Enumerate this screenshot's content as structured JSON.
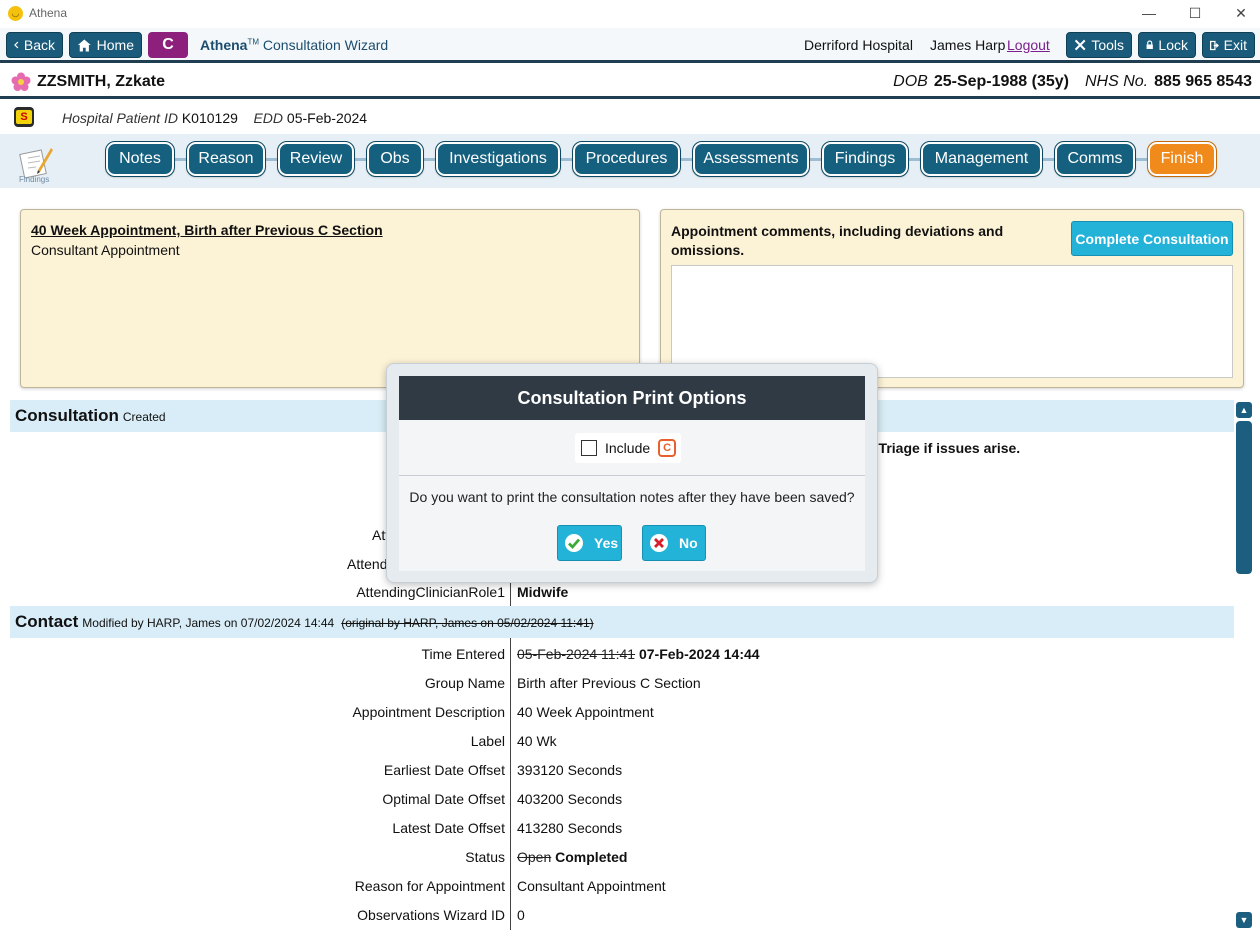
{
  "window": {
    "title": "Athena",
    "minimize": "—",
    "maximize": "☐",
    "close": "✕"
  },
  "topnav": {
    "back": "Back",
    "home": "Home",
    "c_badge": "C",
    "app_name": "Athena",
    "tm": "TM",
    "app_sub": "Consultation Wizard",
    "hospital": "Derriford Hospital",
    "user": "James Harp",
    "logout": "Logout",
    "tools": "Tools",
    "lock": "Lock",
    "exit": "Exit"
  },
  "patient": {
    "name": "ZZSMITH, Zzkate",
    "dob_label": "DOB",
    "dob_value": "25-Sep-1988 (35y)",
    "nhs_label": "NHS No.",
    "nhs_value": "885 965 8543",
    "id_label": "Hospital Patient ID",
    "id_value": "K010129",
    "edd_label": "EDD",
    "edd_value": "05-Feb-2024"
  },
  "wizard": {
    "icon_label": "Findings",
    "tabs": [
      "Notes",
      "Reason",
      "Review",
      "Obs",
      "Investigations",
      "Procedures",
      "Assessments",
      "Findings",
      "Management",
      "Comms",
      "Finish"
    ]
  },
  "appointment": {
    "title": "40 Week Appointment, Birth after Previous C Section",
    "subtitle": "Consultant Appointment",
    "comments_label": "Appointment comments, including deviations and omissions.",
    "complete_button": "Complete Consultation"
  },
  "consultation": {
    "title": "Consultation",
    "meta": "Created",
    "frag_triage": "f Triage if issues arise.",
    "frag_att": "Att",
    "frag_attend": "Attend",
    "role_label": "AttendingClinicianRole1",
    "role_value": "Midwife"
  },
  "contact": {
    "title": "Contact",
    "meta": "Modified by HARP, James on 07/02/2024 14:44",
    "original": "(original by HARP, James on 05/02/2024 11:41)",
    "rows": [
      {
        "label": "Time Entered",
        "old": "05-Feb-2024 11:41",
        "value": "07-Feb-2024 14:44"
      },
      {
        "label": "Group Name",
        "old": "",
        "value": "Birth after Previous C Section"
      },
      {
        "label": "Appointment Description",
        "old": "",
        "value": "40 Week Appointment"
      },
      {
        "label": "Label",
        "old": "",
        "value": "40 Wk"
      },
      {
        "label": "Earliest Date Offset",
        "old": "",
        "value": "393120 Seconds"
      },
      {
        "label": "Optimal Date Offset",
        "old": "",
        "value": "403200 Seconds"
      },
      {
        "label": "Latest Date Offset",
        "old": "",
        "value": "413280 Seconds"
      },
      {
        "label": "Status",
        "old": "Open",
        "value": "Completed"
      },
      {
        "label": "Reason for Appointment",
        "old": "",
        "value": "Consultant Appointment"
      },
      {
        "label": "Observations Wizard ID",
        "old": "",
        "value": "0"
      }
    ]
  },
  "modal": {
    "title": "Consultation Print Options",
    "include_label": "Include",
    "include_icon_letter": "C",
    "question": "Do you want to print the consultation notes after they have been saved?",
    "yes": "Yes",
    "no": "No"
  },
  "colors": {
    "nav": "#1a5a7a",
    "finish": "#f08a1a",
    "accent": "#23b2d8",
    "c_badge": "#8d1f7d"
  }
}
